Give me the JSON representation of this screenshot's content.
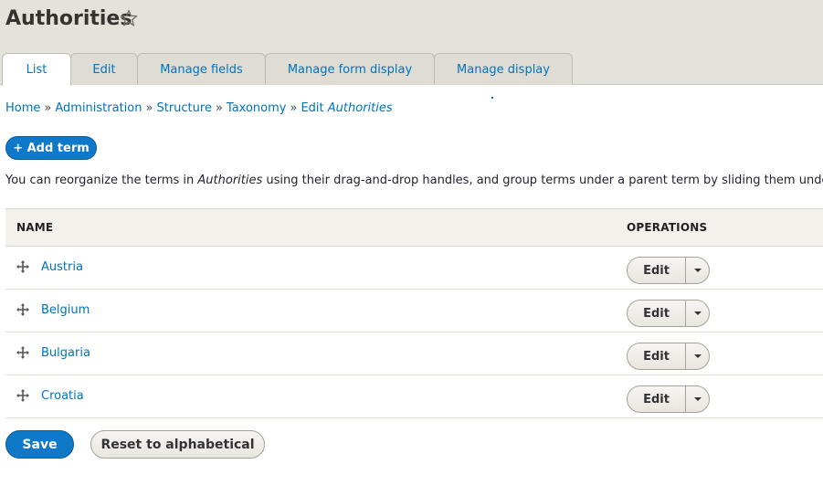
{
  "page": {
    "title": "Authorities"
  },
  "tabs": [
    {
      "label": "List",
      "active": true
    },
    {
      "label": "Edit",
      "active": false
    },
    {
      "label": "Manage fields",
      "active": false
    },
    {
      "label": "Manage form display",
      "active": false
    },
    {
      "label": "Manage display",
      "active": false
    }
  ],
  "breadcrumb": {
    "home": "Home",
    "administration": "Administration",
    "structure": "Structure",
    "taxonomy": "Taxonomy",
    "edit_prefix": "Edit",
    "edit_vocab": "Authorities",
    "separator": "»"
  },
  "add_term": {
    "label": "+ Add term"
  },
  "help": {
    "before": "You can reorganize the terms in ",
    "vocab": "Authorities",
    "after": " using their drag-and-drop handles, and group terms under a parent term by sliding them under a"
  },
  "table": {
    "col_name": "NAME",
    "col_ops": "OPERATIONS",
    "rows": [
      {
        "name": "Austria",
        "op": "Edit"
      },
      {
        "name": "Belgium",
        "op": "Edit"
      },
      {
        "name": "Bulgaria",
        "op": "Edit"
      },
      {
        "name": "Croatia",
        "op": "Edit"
      }
    ]
  },
  "actions": {
    "save": "Save",
    "reset": "Reset to alphabetical"
  },
  "colors": {
    "primary": "#0e78c9",
    "link": "#0074bd",
    "header_bg": "#e4e3db"
  },
  "icons": {
    "favorite": "star-icon",
    "drag": "drag-handle-icon",
    "dropdown": "chevron-down-icon"
  }
}
